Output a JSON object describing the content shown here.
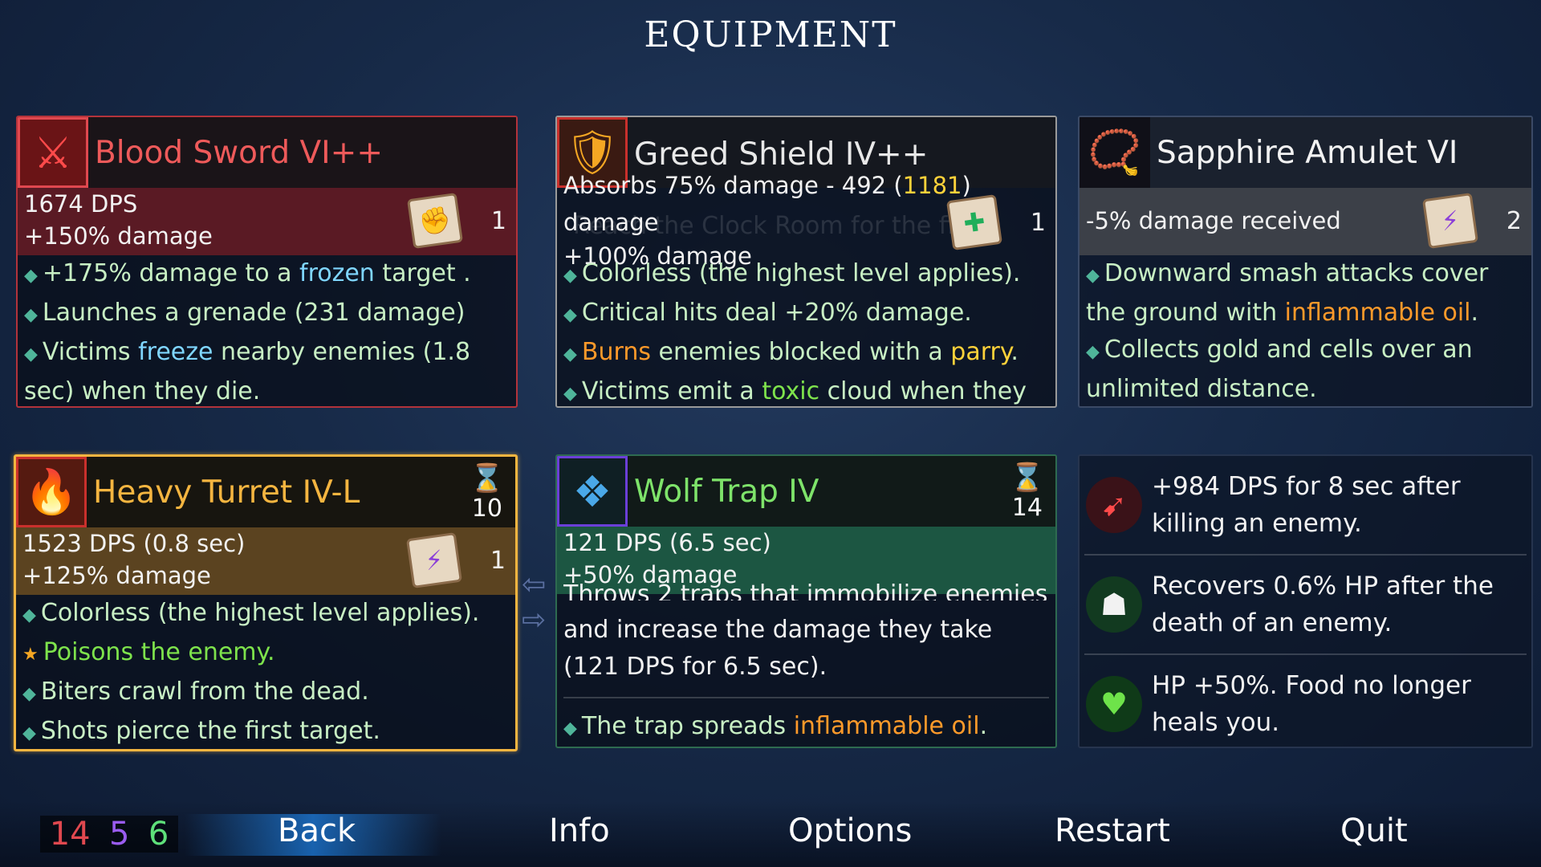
{
  "screen_title": "EQUIPMENT",
  "background_text": "Reach the Clock Room for the fi",
  "colors": {
    "red": "#e0484f",
    "orange_turret": "#f5b540",
    "green": "#7ee36a",
    "affix_green": "#c8efc4",
    "cold": "#7fd6ff",
    "fire": "#ff9a2a",
    "gold": "#ffd23a"
  },
  "cards": {
    "blood_sword": {
      "icon": "blood-sword-icon",
      "name": "Blood Sword VI++",
      "stat1": "1674 DPS",
      "stat2": "+150% damage",
      "scroll_icon": "brutality-scroll-icon",
      "scroll_count": "1",
      "affix1_pre": "+175% damage to a ",
      "affix1_hl": "frozen",
      "affix1_post": " target .",
      "affix2": "Launches a grenade (231 damage)",
      "affix3_pre": "Victims ",
      "affix3_hl": "freeze",
      "affix3_post": " nearby enemies (1.8 sec) when they die."
    },
    "greed_shield": {
      "icon": "greed-shield-icon",
      "name": "Greed Shield IV++",
      "stat1_pre": "Absorbs 75% damage - 492 (",
      "stat1_hl": "1181",
      "stat1_post": ")",
      "stat2": "damage",
      "stat3": "+100% damage",
      "scroll_icon": "survival-scroll-icon",
      "scroll_count": "1",
      "affix1": "Colorless (the highest level applies).",
      "affix2": "Critical hits deal +20% damage.",
      "affix3_hl": "Burns",
      "affix3_mid": " enemies blocked with a ",
      "affix3_hl2": "parry",
      "affix3_post": ".",
      "affix4_pre": "Victims emit a ",
      "affix4_hl": "toxic",
      "affix4_post": " cloud when they die."
    },
    "sapphire_amulet": {
      "icon": "sapphire-amulet-icon",
      "name": "Sapphire Amulet VI",
      "stat1": "-5% damage received",
      "scroll_icon": "tactics-scroll-icon",
      "scroll_count": "2",
      "affix1_pre": "Downward smash attacks cover the ground with ",
      "affix1_hl": "inflammable oil",
      "affix1_post": ".",
      "affix2": "Collects gold and cells over an unlimited distance."
    },
    "heavy_turret": {
      "icon": "heavy-turret-icon",
      "name": "Heavy Turret IV-L",
      "timer_icon": "hourglass-icon",
      "timer": "10",
      "stat1": "1523 DPS (0.8 sec)",
      "stat2": "+125% damage",
      "scroll_icon": "tactics-scroll-icon",
      "scroll_count": "1",
      "affix1": "Colorless (the highest level applies).",
      "affix2": "Poisons the enemy.",
      "affix2_icon": "star-icon",
      "affix3": "Biters crawl from the dead.",
      "affix4": "Shots pierce the first target."
    },
    "wolf_trap": {
      "icon": "wolf-trap-icon",
      "name": "Wolf Trap IV",
      "timer_icon": "hourglass-icon",
      "timer": "14",
      "stat1": "121 DPS (6.5 sec)",
      "stat2": "+50% damage",
      "desc_cut": "Throws 2 traps that immobilize enemies",
      "desc": "and increase the damage they take (121 DPS for 6.5 sec).",
      "affix1_pre": "The trap spreads ",
      "affix1_hl": "inflammable oil",
      "affix1_post": "."
    }
  },
  "mutations": [
    {
      "icon": "mutation-crossbow-icon",
      "text": "+984 DPS for 8 sec after killing an enemy."
    },
    {
      "icon": "mutation-fangs-icon",
      "text": "Recovers 0.6% HP after the death of an enemy."
    },
    {
      "icon": "mutation-heart-icon",
      "text": "HP +50%. Food no longer heals you."
    }
  ],
  "footer": {
    "scroll_red": "14",
    "scroll_purple": "5",
    "scroll_green": "6",
    "back": "Back",
    "info": "Info",
    "options": "Options",
    "restart": "Restart",
    "quit": "Quit"
  }
}
